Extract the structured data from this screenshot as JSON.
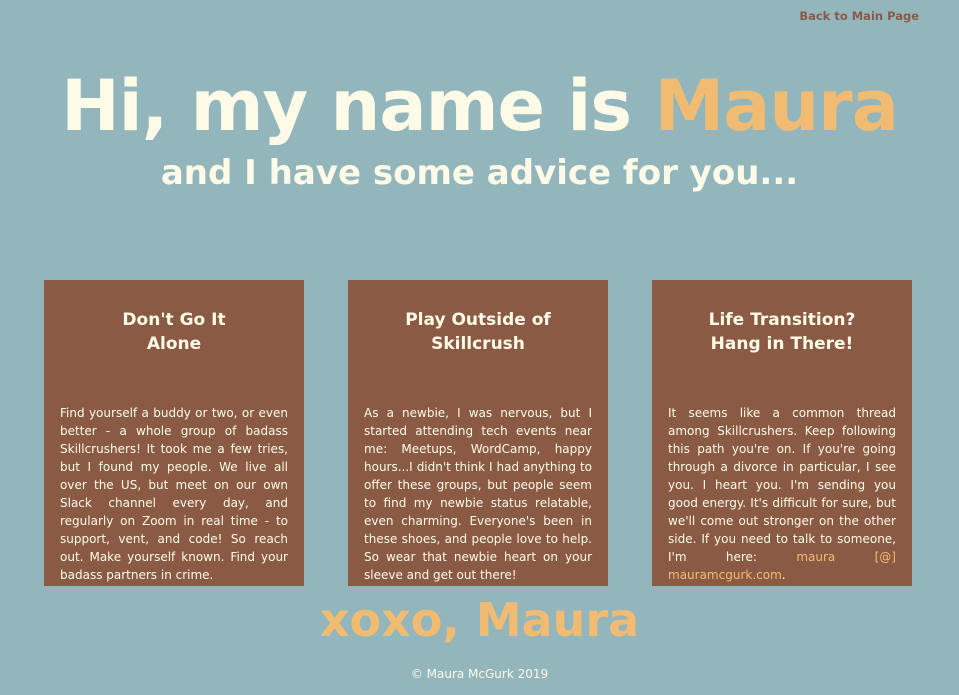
{
  "nav": {
    "back_label": "Back to Main Page"
  },
  "hero": {
    "title_prefix": "Hi, my name is ",
    "title_name": "Maura",
    "subtitle": "and I have some advice for you..."
  },
  "cards": [
    {
      "title_line1": "Don't Go It",
      "title_line2": "Alone",
      "body": "Find yourself a buddy or two, or even better - a whole group of badass Skillcrushers! It took me a few tries, but I found my people. We live all over the US, but meet on our own Slack channel every day, and regularly on Zoom in real time - to support, vent, and code! So reach out. Make yourself known. Find your badass partners in crime."
    },
    {
      "title_line1": "Play Outside of",
      "title_line2": "Skillcrush",
      "body": "As a newbie, I was nervous, but I started attending tech events near me: Meetups, WordCamp, happy hours...I didn't think I had anything to offer these groups, but people seem to find my newbie status relatable, even charming. Everyone's been in these shoes, and people love to help. So wear that newbie heart on your sleeve and get out there!"
    },
    {
      "title_line1": "Life Transition?",
      "title_line2": "Hang in There!",
      "body": "It seems like a common thread among Skillcrushers. Keep following this path you're on. If you're going through a divorce in particular, I see you. I heart you. I'm sending you good energy. It's difficult for sure, but we'll come out stronger on the other side. If you need to talk to someone, I'm here: ",
      "email": "maura [@] mauramcgurk.com",
      "body_end": "."
    }
  ],
  "signoff": "xoxo, Maura",
  "footer": "© Maura McGurk 2019",
  "colors": {
    "background": "#93b6bd",
    "card": "#8b5a44",
    "cream": "#fdfbe7",
    "accent": "#f2bb72"
  }
}
